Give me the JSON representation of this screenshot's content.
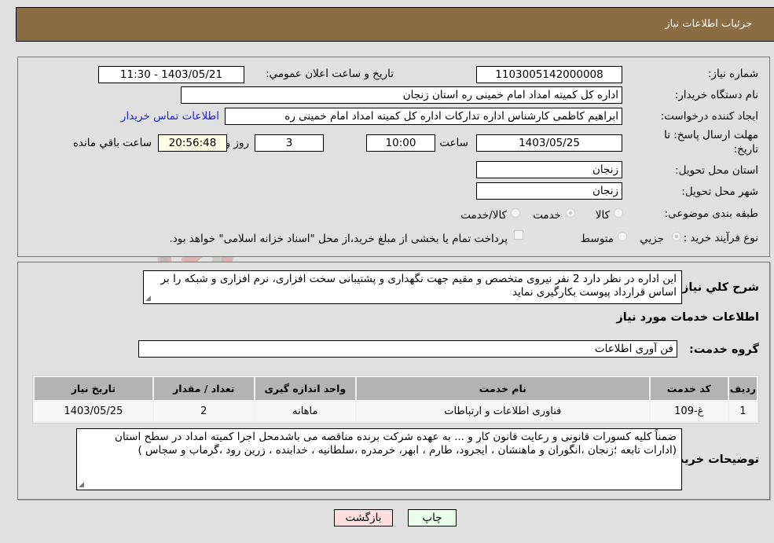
{
  "header": {
    "title": "جزئیات اطلاعات نیاز"
  },
  "details": {
    "need_number": {
      "label": "شماره نیاز:",
      "value": "1103005142000008"
    },
    "announce_datetime": {
      "label": "تاریخ و ساعت اعلان عمومي:",
      "value": "1403/05/21 - 11:30"
    },
    "buyer_org": {
      "label": "نام دستگاه خریدار:",
      "value": "اداره کل کمیته امداد امام خمینی  ره  استان زنجان"
    },
    "requester": {
      "label": "ایجاد کننده درخواست:",
      "value": "ابراهیم  کاظمی  کارشناس اداره تدارکات  اداره کل کمیته امداد امام خمینی  ره",
      "contact_link": "اطلاعات تماس خریدار"
    },
    "deadline": {
      "label_line1": "مهلت ارسال پاسخ: تا",
      "label_line2": "تاریخ:",
      "date": "1403/05/25",
      "time_label": "ساعت",
      "time": "10:00",
      "days": "3",
      "days_label": "روز و",
      "remaining": "20:56:48",
      "remaining_label": "ساعت باقي مانده"
    },
    "delivery_province": {
      "label": "استان محل تحویل:",
      "value": "زنجان"
    },
    "delivery_city": {
      "label": "شهر محل تحویل:",
      "value": "زنجان"
    },
    "category": {
      "label": "طبقه بندی موضوعی:",
      "options": [
        "کالا",
        "خدمت",
        "کالا/خدمت"
      ],
      "selected": "خدمت"
    },
    "purchase_type": {
      "label": "نوع فرآیند خرید :",
      "options": [
        "جزيي",
        "متوسط"
      ],
      "selected": "جزيي",
      "treasury_note": "پرداخت تمام یا بخشی از مبلغ خرید،از محل \"اسناد خزانه اسلامی\" خواهد بود.",
      "treasury_checked": false
    }
  },
  "description": {
    "label": "شرح كلي نیاز:",
    "value": "این اداره در نظر دارد 2 نفر نیروی متخصص و مقیم جهت  نگهداری و پشتیبانی سخت افزاری، نرم افزاری و شبکه را بر اساس قرارداد پیوست بکارگیری نماید"
  },
  "services": {
    "section_title": "اطلاعات خدمات مورد نیاز",
    "group_label": "گروه خدمت:",
    "group_value": "فن آوری اطلاعات",
    "columns": [
      "ردیف",
      "کد خدمت",
      "نام خدمت",
      "واحد اندازه گیری",
      "تعداد / مقدار",
      "تاریخ نیاز"
    ],
    "rows": [
      [
        "1",
        "غ-109",
        "فناوری اطلاعات و ارتباطات",
        "ماهانه",
        "2",
        "1403/05/25"
      ]
    ]
  },
  "buyer_notes": {
    "label": "توضیحات خریدار:",
    "value": "ضمناً کلیه کسورات قانونی و رعایت قانون کار و ... به عهده شرکت برنده مناقصه می باشدمحل اجرا کمیته امداد در سطح استان (ادارات تابعه ؛زنجان ،انگوران و ماهنشان ، ایجرود، طارم ، ابهر، خرمدره ،سلطانیه ، خدابنده ، زرین رود ،گرماب و سجاس )"
  },
  "buttons": {
    "print": "چاپ",
    "back": "بازگشت"
  },
  "colors": {
    "header_bg": "#8c6c42",
    "print_bg": "#eaffea",
    "back_bg": "#ffdede",
    "link": "#2222cc"
  },
  "watermark": {
    "text": "AriaTender.neT"
  }
}
